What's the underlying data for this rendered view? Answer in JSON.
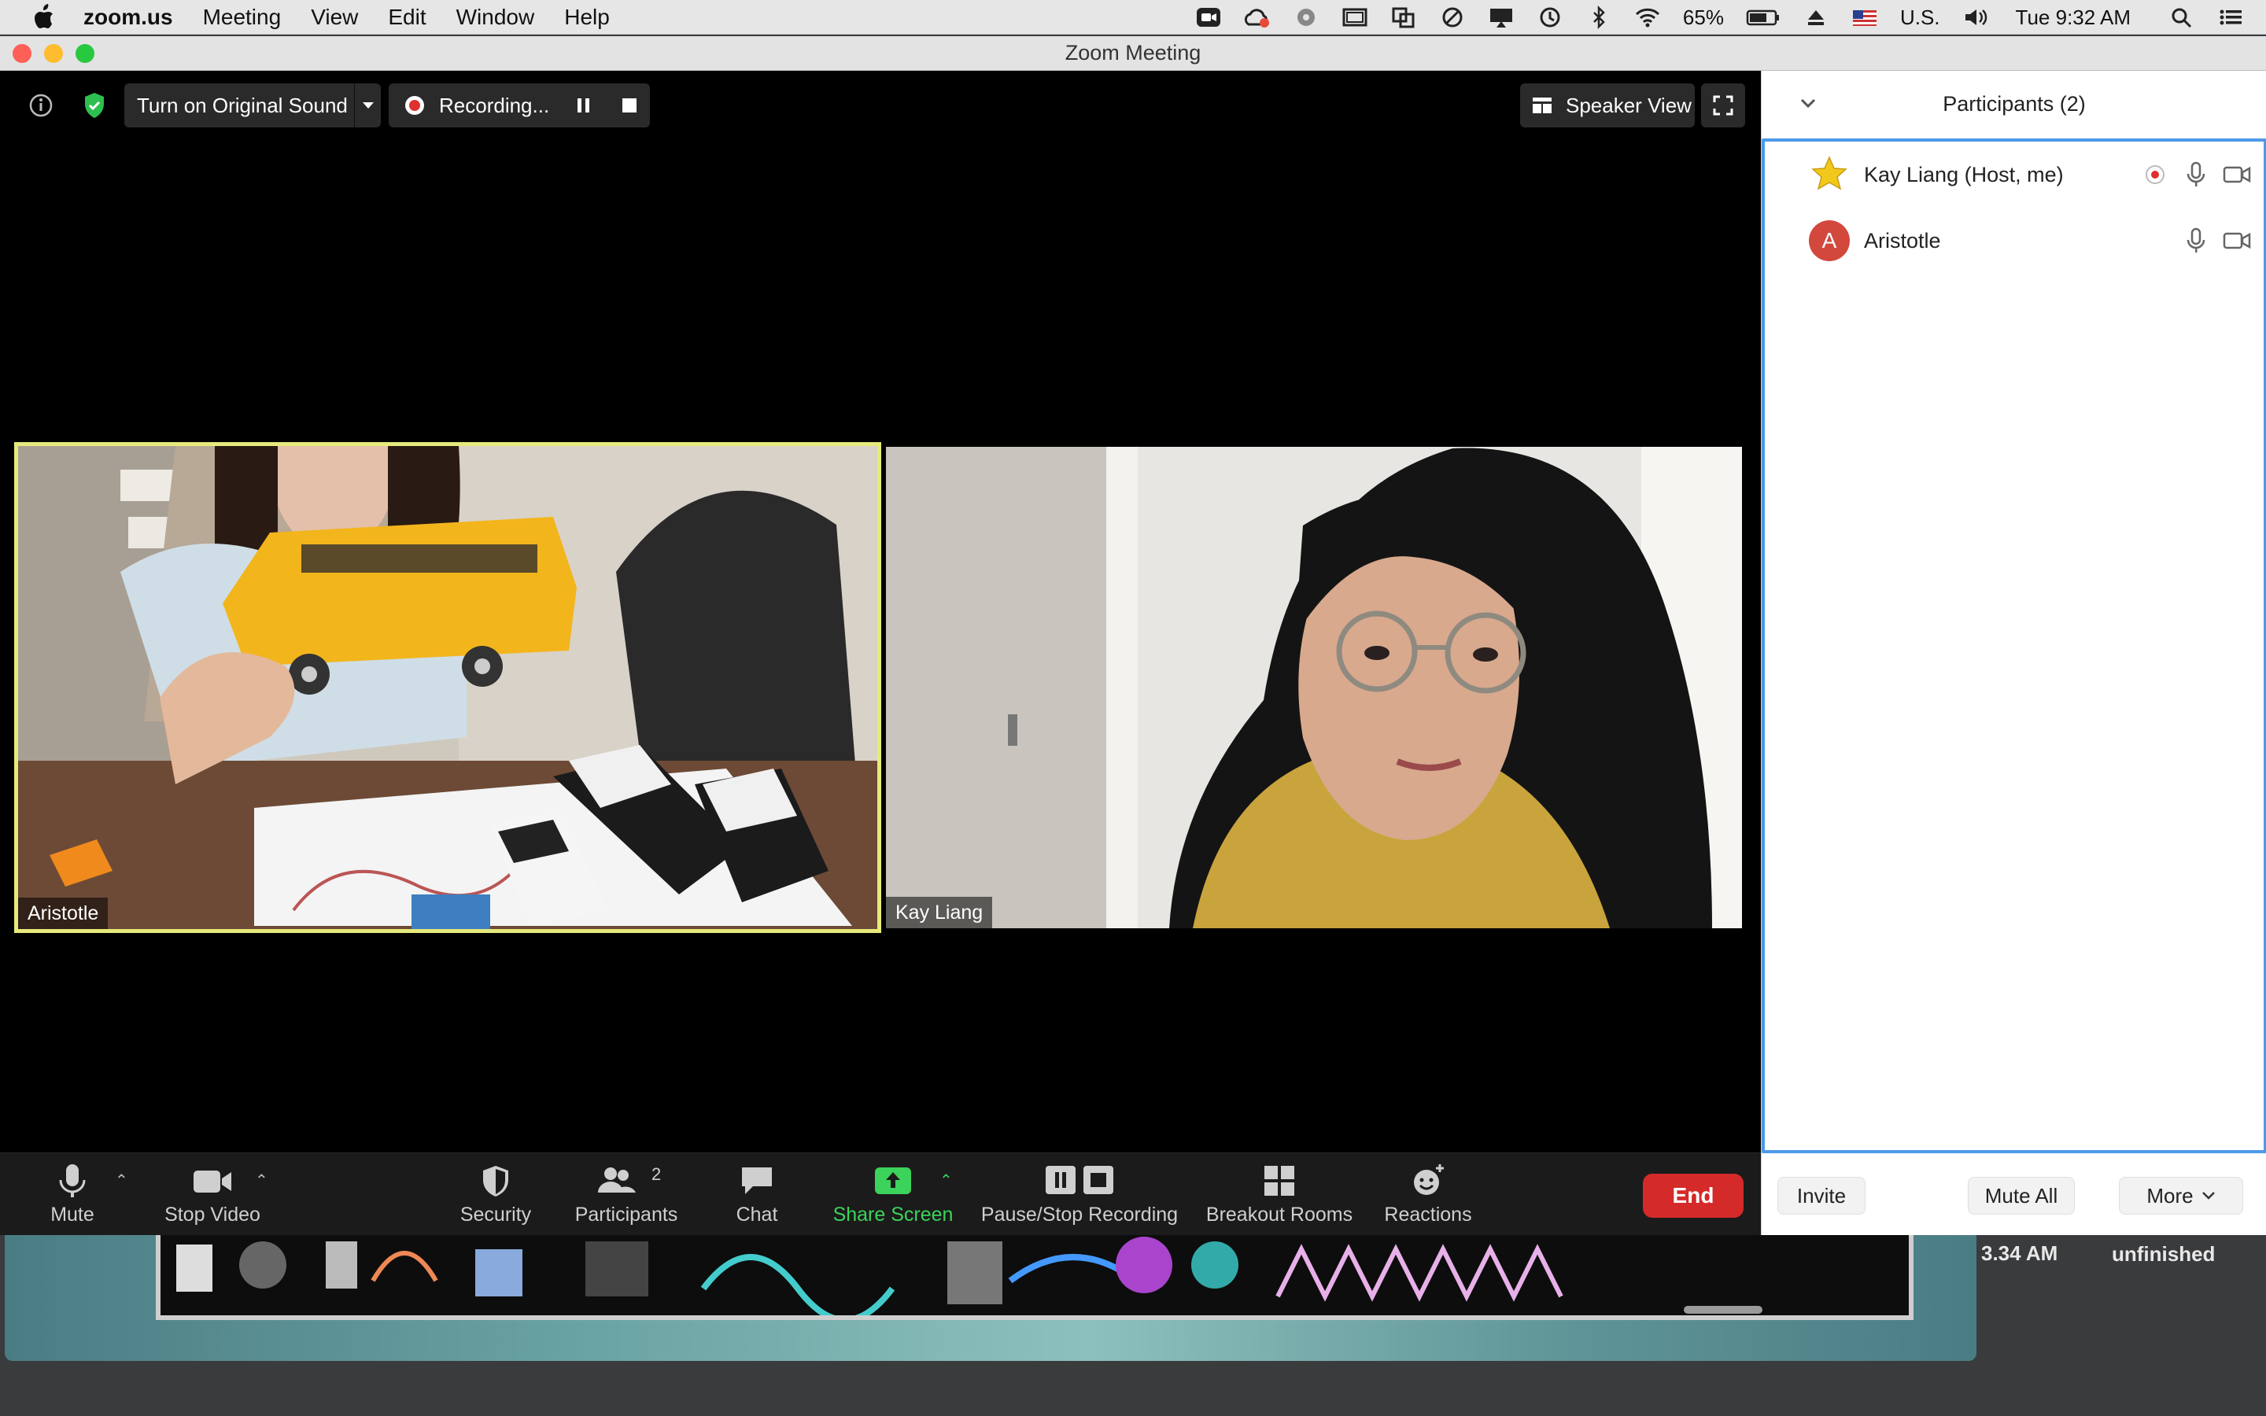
{
  "menubar": {
    "app_name": "zoom.us",
    "items": [
      "Meeting",
      "View",
      "Edit",
      "Window",
      "Help"
    ],
    "battery": "65%",
    "input_source": "U.S.",
    "clock": "Tue 9:32 AM"
  },
  "window": {
    "title": "Zoom Meeting"
  },
  "top_controls": {
    "original_sound_label": "Turn on Original Sound",
    "recording_label": "Recording...",
    "speaker_view_label": "Speaker View"
  },
  "videos": [
    {
      "name": "Aristotle"
    },
    {
      "name": "Kay Liang"
    }
  ],
  "toolbar": {
    "mute": "Mute",
    "stop_video": "Stop Video",
    "security": "Security",
    "participants": "Participants",
    "participants_count": "2",
    "chat": "Chat",
    "share_screen": "Share Screen",
    "pause_stop_recording": "Pause/Stop Recording",
    "breakout_rooms": "Breakout Rooms",
    "reactions": "Reactions",
    "end": "End"
  },
  "panel": {
    "title": "Participants (2)",
    "participants": [
      {
        "name": "Kay Liang (Host, me)",
        "avatar": "star-icon",
        "recording": true
      },
      {
        "name": "Aristotle",
        "avatar_letter": "A",
        "avatar_color": "#d2483d",
        "recording": false
      }
    ],
    "invite": "Invite",
    "mute_all": "Mute All",
    "more": "More"
  },
  "desktop": {
    "text_left": "3.34 AM",
    "text_right": "unfinished"
  },
  "colors": {
    "share_green": "#3bd35b",
    "end_red": "#d42a2a",
    "panel_border": "#4d9ae8",
    "active_speaker_border": "#e6ea7b"
  }
}
